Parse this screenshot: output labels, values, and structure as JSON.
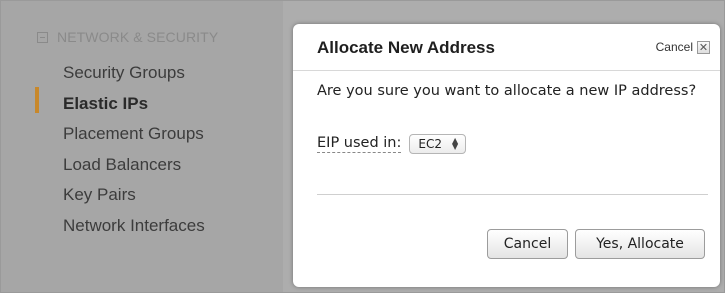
{
  "sidebar": {
    "section_title": "NETWORK & SECURITY",
    "items": [
      {
        "label": "Security Groups"
      },
      {
        "label": "Elastic IPs"
      },
      {
        "label": "Placement Groups"
      },
      {
        "label": "Load Balancers"
      },
      {
        "label": "Key Pairs"
      },
      {
        "label": "Network Interfaces"
      }
    ],
    "active_index": 1,
    "active_color": "#c8882b"
  },
  "dialog": {
    "title": "Allocate New Address",
    "cancel_link": "Cancel",
    "close_icon": "close-x-icon",
    "question": "Are you sure you want to allocate a new IP address?",
    "eip_label": "EIP used in:",
    "eip_select_value": "EC2",
    "cancel_button": "Cancel",
    "confirm_button": "Yes, Allocate"
  }
}
